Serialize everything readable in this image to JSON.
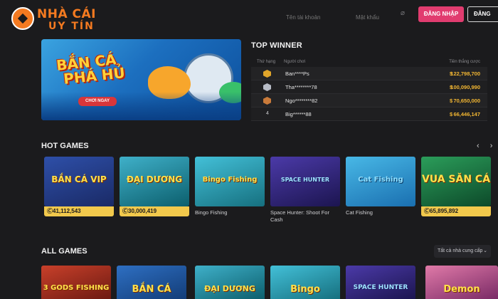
{
  "header": {
    "logo_line1": "NHÀ CÁI",
    "logo_line2": "UY TÍN",
    "username_placeholder": "Tên tài khoản",
    "password_placeholder": "Mật khẩu",
    "login_label": "ĐĂNG NHẬP",
    "register_label": "ĐĂNG"
  },
  "banner": {
    "title_line1": "BẮN CÁ",
    "title_line2": "PHÁ HỦ",
    "cta_label": "CHƠI NGAY"
  },
  "top_winner": {
    "title": "TOP WINNER",
    "columns": [
      "Thứ hạng",
      "Người chơi",
      "Tiền thắng cược"
    ],
    "currency_symbol": "$",
    "rows": [
      {
        "rank": "1",
        "medal": "gold-medal-icon",
        "player": "Ban****Ps",
        "amount": "122,798,700"
      },
      {
        "rank": "2",
        "medal": "silver-medal-icon",
        "player": "Tha********78",
        "amount": "100,090,990"
      },
      {
        "rank": "3",
        "medal": "bronze-medal-icon",
        "player": "Ngo********82",
        "amount": "70,650,000"
      },
      {
        "rank": "4",
        "medal": "",
        "player": "Big******88",
        "amount": "66,446,147"
      }
    ]
  },
  "hot_games": {
    "title": "HOT GAMES",
    "prev_icon": "chevron-left-icon",
    "next_icon": "chevron-right-icon",
    "items": [
      {
        "thumb_text": "BẮN CÁ VIP",
        "jackpot": "41,112,543",
        "name": ""
      },
      {
        "thumb_text": "ĐẠI DƯƠNG",
        "jackpot": "30,000,419",
        "name": ""
      },
      {
        "thumb_text": "Bingo Fishing",
        "jackpot": "",
        "name": "Bingo Fishing"
      },
      {
        "thumb_text": "SPACE HUNTER",
        "jackpot": "",
        "name": "Space Hunter: Shoot For Cash"
      },
      {
        "thumb_text": "Cat Fishing",
        "jackpot": "",
        "name": "Cat Fishing"
      },
      {
        "thumb_text": "VUA SĂN CÁ",
        "jackpot": "65,895,892",
        "name": ""
      }
    ]
  },
  "all_games": {
    "title": "ALL GAMES",
    "provider_select": "Tất cả nhà cung cấp",
    "items": [
      {
        "thumb_text": "3 GODS FISHING"
      },
      {
        "thumb_text": "BẮN CÁ"
      },
      {
        "thumb_text": "ĐẠI DƯƠNG"
      },
      {
        "thumb_text": "Bingo"
      },
      {
        "thumb_text": "SPACE HUNTER"
      },
      {
        "thumb_text": "Demon"
      }
    ]
  },
  "colors": {
    "background": "#1b1b1d",
    "accent_orange": "#f47a20",
    "login_button": "#e13c6f",
    "gold": "#f2b632",
    "jackpot_bar": "#f2c94c"
  }
}
